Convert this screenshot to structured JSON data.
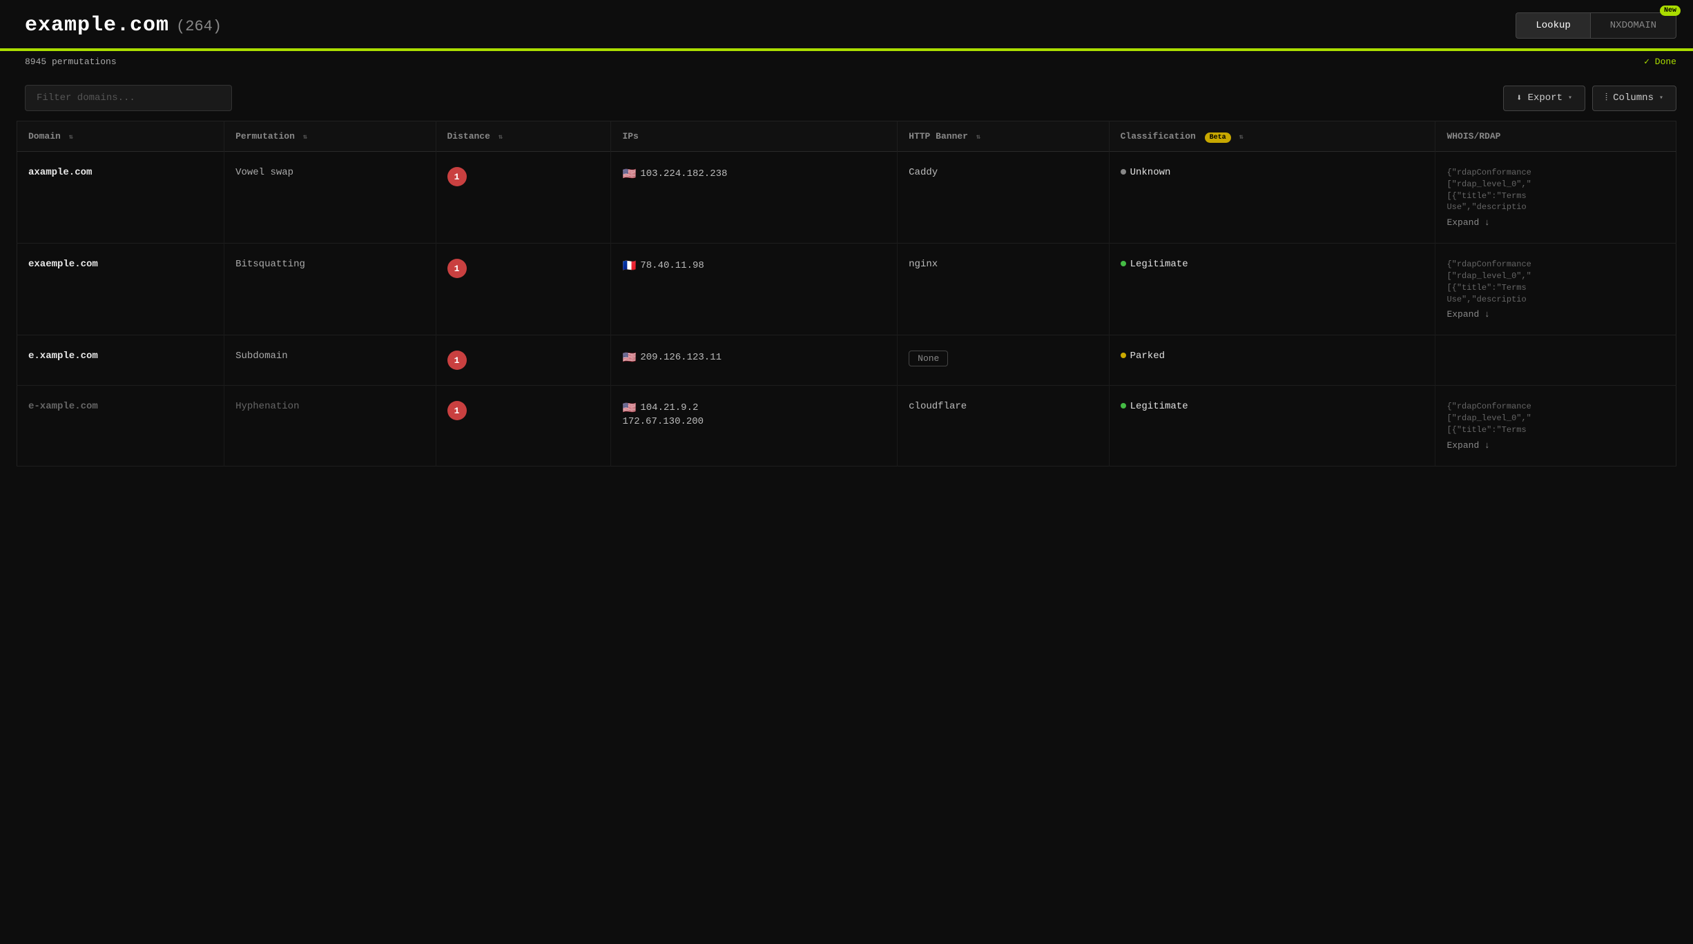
{
  "header": {
    "title": "example.com",
    "count": "(264)",
    "lookup_label": "Lookup",
    "nxdomain_label": "NXDOMAIN",
    "new_badge": "New"
  },
  "progress": {
    "permutations_label": "8945 permutations",
    "status": "Done",
    "percent": 100
  },
  "toolbar": {
    "filter_placeholder": "Filter domains...",
    "export_label": "Export",
    "columns_label": "Columns"
  },
  "table": {
    "columns": [
      {
        "key": "domain",
        "label": "Domain"
      },
      {
        "key": "permutation",
        "label": "Permutation"
      },
      {
        "key": "distance",
        "label": "Distance"
      },
      {
        "key": "ips",
        "label": "IPs"
      },
      {
        "key": "http_banner",
        "label": "HTTP Banner"
      },
      {
        "key": "classification",
        "label": "Classification",
        "badge": "Beta"
      },
      {
        "key": "whois",
        "label": "WHOIS/RDAP"
      }
    ],
    "rows": [
      {
        "domain": "axample.com",
        "permutation": "Vowel swap",
        "distance": "1",
        "ips": [
          {
            "flag": "🇺🇸",
            "ip": "103.224.182.238"
          }
        ],
        "http_banner": "Caddy",
        "classification": "Unknown",
        "classification_type": "unknown",
        "whois_lines": [
          "{\"rdapConformance",
          "[\"rdap_level_0\",\"",
          "[{\"title\":\"Terms",
          "Use\",\"descriptio"
        ],
        "expand": true
      },
      {
        "domain": "exaemple.com",
        "permutation": "Bitsquatting",
        "distance": "1",
        "ips": [
          {
            "flag": "🇫🇷",
            "ip": "78.40.11.98"
          }
        ],
        "http_banner": "nginx",
        "classification": "Legitimate",
        "classification_type": "legitimate",
        "whois_lines": [
          "{\"rdapConformance",
          "[\"rdap_level_0\",\"",
          "[{\"title\":\"Terms",
          "Use\",\"descriptio"
        ],
        "expand": true
      },
      {
        "domain": "e.xample.com",
        "permutation": "Subdomain",
        "distance": "1",
        "ips": [
          {
            "flag": "🇺🇸",
            "ip": "209.126.123.11"
          }
        ],
        "http_banner": "None",
        "http_banner_type": "none",
        "classification": "Parked",
        "classification_type": "parked",
        "whois_lines": [],
        "expand": false
      },
      {
        "domain": "e-xample.com",
        "permutation": "Hyphenation",
        "distance": "1",
        "ips": [
          {
            "flag": "🇺🇸",
            "ip": "104.21.9.2"
          },
          {
            "flag": "",
            "ip": "172.67.130.200"
          }
        ],
        "http_banner": "cloudflare",
        "classification": "Legitimate",
        "classification_type": "legitimate",
        "whois_lines": [
          "{\"rdapConformance",
          "[\"rdap_level_0\",\"",
          "[{\"title\":\"Terms"
        ],
        "expand": true
      }
    ]
  }
}
